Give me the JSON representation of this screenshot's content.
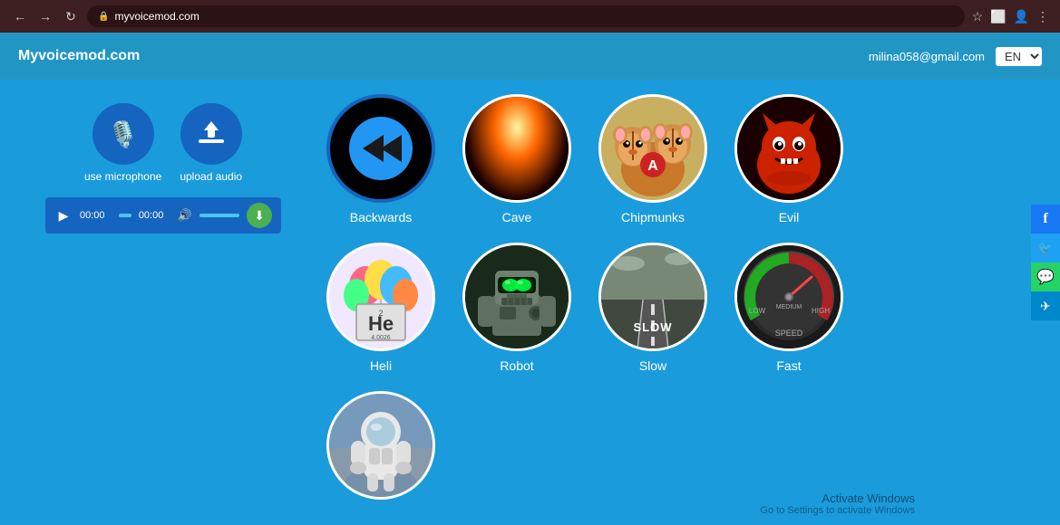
{
  "browser": {
    "url": "myvoicemod.com",
    "nav": {
      "back": "←",
      "forward": "→",
      "reload": "↺"
    }
  },
  "header": {
    "logo": "Myvoicemod.com",
    "email": "milina058@gmail.com",
    "lang": "EN"
  },
  "left_panel": {
    "mic_label": "use microphone",
    "upload_label": "upload audio",
    "player": {
      "time_current": "00:00",
      "time_total": "00:00"
    }
  },
  "voices": {
    "row1": [
      {
        "id": "backwards",
        "label": "Backwards",
        "selected": true
      },
      {
        "id": "cave",
        "label": "Cave",
        "selected": false
      },
      {
        "id": "chipmunks",
        "label": "Chipmunks",
        "selected": false
      },
      {
        "id": "evil",
        "label": "Evil",
        "selected": false
      }
    ],
    "row2": [
      {
        "id": "heli",
        "label": "Heli",
        "selected": false
      },
      {
        "id": "robot",
        "label": "Robot",
        "selected": false
      },
      {
        "id": "slow",
        "label": "Slow",
        "selected": false
      },
      {
        "id": "fast",
        "label": "Fast",
        "selected": false
      }
    ],
    "row3": [
      {
        "id": "astronaut",
        "label": "",
        "selected": false
      }
    ]
  },
  "social": {
    "facebook": "f",
    "twitter": "🐦",
    "whatsapp": "✓",
    "telegram": "✈"
  },
  "activate_windows": {
    "title": "Activate Windows",
    "subtitle": "Go to Settings to activate Windows"
  }
}
